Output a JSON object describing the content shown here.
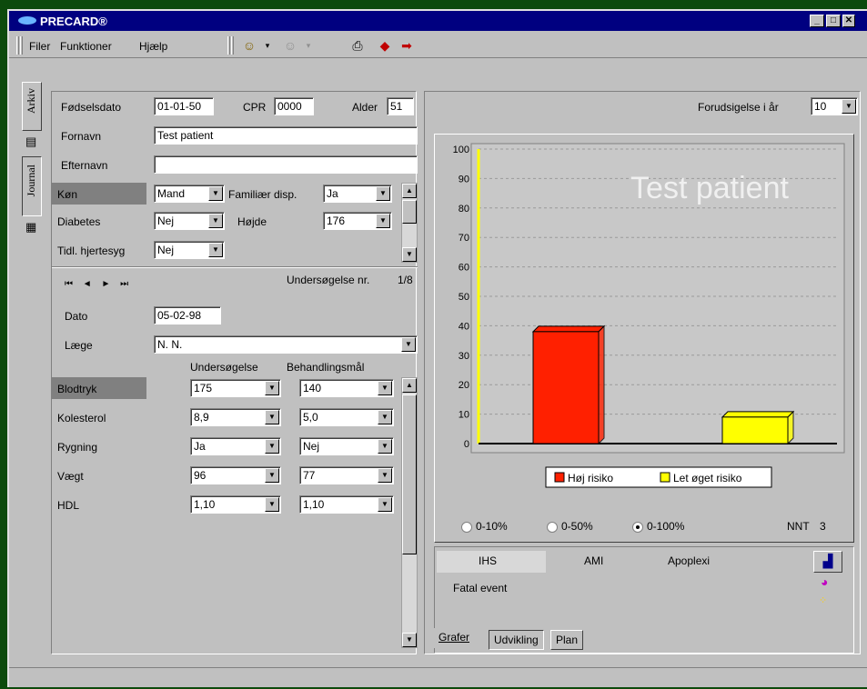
{
  "window": {
    "title": "PRECARD®"
  },
  "menu": {
    "file": "Filer",
    "functions": "Funktioner",
    "help": "Hjælp"
  },
  "tabs": {
    "archive": "Arkiv",
    "journal": "Journal"
  },
  "patient": {
    "birthdate_label": "Fødselsdato",
    "birthdate": "01-01-50",
    "cpr_label": "CPR",
    "cpr": "0000",
    "age_label": "Alder",
    "age": "51",
    "firstname_label": "Fornavn",
    "firstname": "Test patient",
    "lastname_label": "Efternavn",
    "lastname": "",
    "sex_label": "Køn",
    "sex": "Mand",
    "family_label": "Familiær disp.",
    "family": "Ja",
    "diabetes_label": "Diabetes",
    "diabetes": "Nej",
    "height_label": "Højde",
    "height": "176",
    "prior_label": "Tidl. hjertesyg",
    "prior": "Nej"
  },
  "exam": {
    "nav": {
      "first": "⏮",
      "prev": "◄",
      "next": "►",
      "last": "⏭"
    },
    "number_label": "Undersøgelse nr.",
    "number": "1/8",
    "date_label": "Dato",
    "date": "05-02-98",
    "doctor_label": "Læge",
    "doctor": "N. N.",
    "col_exam": "Undersøgelse",
    "col_goal": "Behandlingsmål",
    "rows": [
      {
        "label": "Blodtryk",
        "exam": "175",
        "goal": "140"
      },
      {
        "label": "Kolesterol",
        "exam": "8,9",
        "goal": "5,0"
      },
      {
        "label": "Rygning",
        "exam": "Ja",
        "goal": "Nej"
      },
      {
        "label": "Vægt",
        "exam": "96",
        "goal": "77"
      },
      {
        "label": "HDL",
        "exam": "1,10",
        "goal": "1,10"
      }
    ]
  },
  "forecast": {
    "label": "Forudsigelse i år",
    "value": "10"
  },
  "chart_data": {
    "type": "bar",
    "title": "Test patient",
    "categories": [
      "Høj risiko",
      "Let øget risiko"
    ],
    "values": [
      38,
      9
    ],
    "colors": [
      "#ff2000",
      "#ffff00"
    ],
    "ylim": [
      0,
      100
    ],
    "yticks": [
      0,
      10,
      20,
      30,
      40,
      50,
      60,
      70,
      80,
      90,
      100
    ],
    "legend": [
      "Høj risiko",
      "Let øget risiko"
    ],
    "grid": true,
    "legend_position": "bottom"
  },
  "scale": {
    "options": [
      "0-10%",
      "0-50%",
      "0-100%"
    ],
    "selected": "0-100%",
    "nnt_label": "NNT",
    "nnt": "3"
  },
  "outcomes": {
    "ihs": "IHS",
    "ami": "AMI",
    "apoplexi": "Apoplexi",
    "fatal": "Fatal event"
  },
  "bottom_tabs": {
    "grafer": "Grafer",
    "udvikling": "Udvikling",
    "plan": "Plan"
  }
}
